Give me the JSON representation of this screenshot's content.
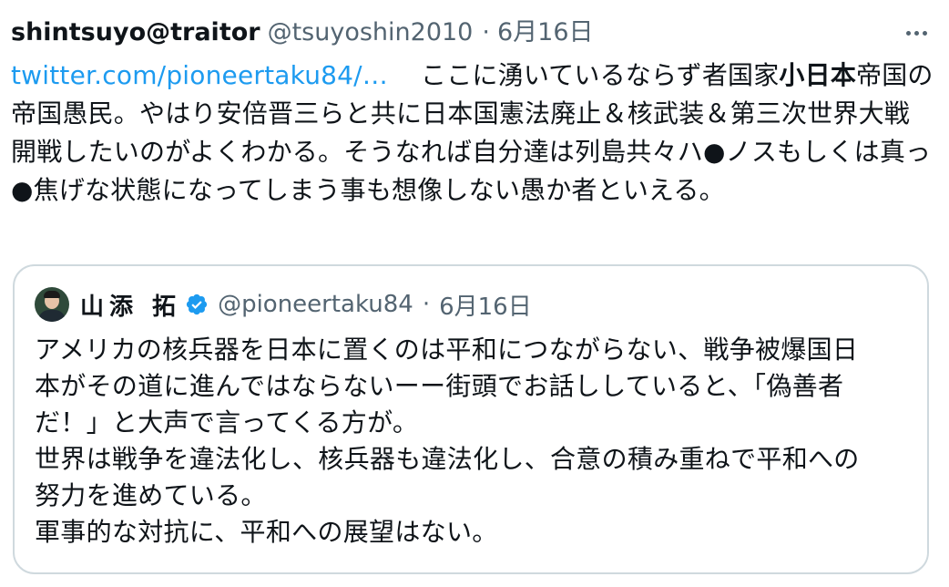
{
  "tweet": {
    "display_name": "shintsuyo@traitor",
    "handle": "@tsuyoshin2010",
    "separator": "·",
    "date": "6月16日",
    "link_text": "twitter.com/pioneertaku84/…",
    "text_before_bold": "ここに湧いているならず者国家",
    "text_bold": "小日本",
    "text_after_bold": "帝国の帝国愚民。やはり安倍晋三らと共に日本国憲法廃止＆核武装＆第三次世界大戦開戦したいのがよくわかる。そうなれば自分達は列島共々ハ●ノスもしくは真っ●焦げな状態になってしまう事も想像しない愚か者といえる。"
  },
  "quote": {
    "display_name": "山添 拓",
    "handle": "@pioneertaku84",
    "separator": "·",
    "date": "6月16日",
    "lines": [
      "アメリカの核兵器を日本に置くのは平和につながらない、戦争被爆国日",
      "本がその道に進んではならないーー街頭でお話ししていると、「偽善者",
      "だ！」と大声で言ってくる方が。",
      "世界は戦争を違法化し、核兵器も違法化し、合意の積み重ねで平和への",
      "努力を進めている。",
      "軍事的な対抗に、平和への展望はない。"
    ]
  },
  "icons": {
    "more": "more-horizontal-icon",
    "verified": "verified-badge-icon",
    "verified_color": "#1d9bf0",
    "link_color": "#1d9bf0",
    "secondary_text_color": "#536471"
  }
}
